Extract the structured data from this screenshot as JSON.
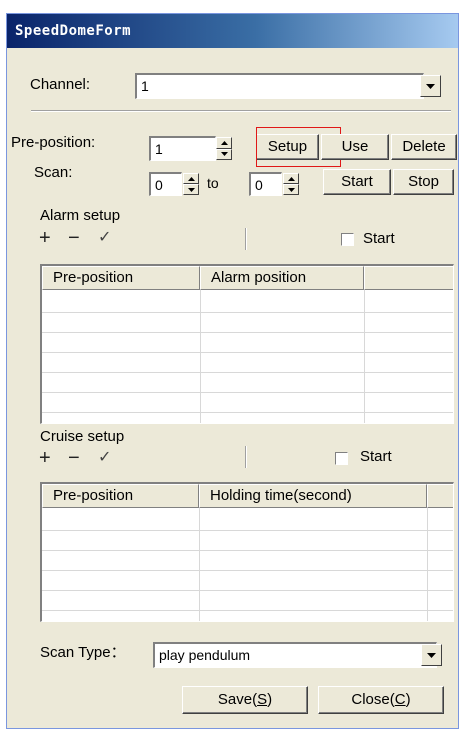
{
  "window": {
    "title": "SpeedDomeForm"
  },
  "channel": {
    "label": "Channel:",
    "value": "1"
  },
  "preposition": {
    "label": "Pre-position:",
    "value": "1",
    "setup_label": "Setup",
    "use_label": "Use",
    "delete_label": "Delete"
  },
  "scan": {
    "label": "Scan:",
    "from_value": "0",
    "to_label": "to",
    "to_value": "0",
    "start_label": "Start",
    "stop_label": "Stop"
  },
  "alarm": {
    "title": "Alarm setup",
    "start_label": "Start",
    "add_icon": "+",
    "remove_icon": "−",
    "confirm_icon": "✓",
    "columns": [
      "Pre-position",
      "Alarm position"
    ]
  },
  "cruise": {
    "title": "Cruise setup",
    "start_label": "Start",
    "add_icon": "+",
    "remove_icon": "−",
    "confirm_icon": "✓",
    "columns": [
      "Pre-position",
      "Holding time(second)"
    ]
  },
  "scan_type": {
    "label": "Scan Type：",
    "value": "play pendulum"
  },
  "footer": {
    "save_text": "Save(",
    "save_key": "S",
    "save_end": ")",
    "close_text": "Close(",
    "close_key": "C",
    "close_end": ")"
  },
  "colors": {
    "title_start": "#0a246a",
    "title_end": "#a6caf0",
    "face": "#ece9d8",
    "focus_box": "#e01818"
  }
}
